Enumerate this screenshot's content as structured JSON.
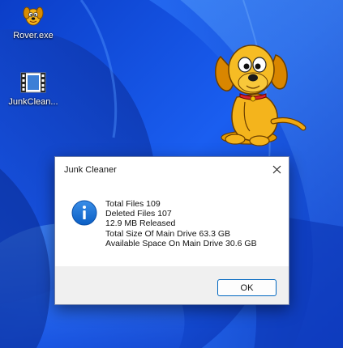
{
  "desktop": {
    "icons": [
      {
        "label": "Rover.exe",
        "icon": "rover-dog-icon"
      },
      {
        "label": "JunkClean...",
        "icon": "film-strip-icon"
      }
    ],
    "wallpaper": "windows-11-bloom-blue"
  },
  "dialog": {
    "title": "Junk Cleaner",
    "icon": "info-icon",
    "messages": [
      "Total Files 109",
      "Deleted Files 107",
      "12.9 MB Released",
      "Total Size Of Main Drive 63.3 GB",
      "Available Space On Main Drive 30.6 GB"
    ],
    "ok_label": "OK",
    "accent": "#0067c0"
  }
}
